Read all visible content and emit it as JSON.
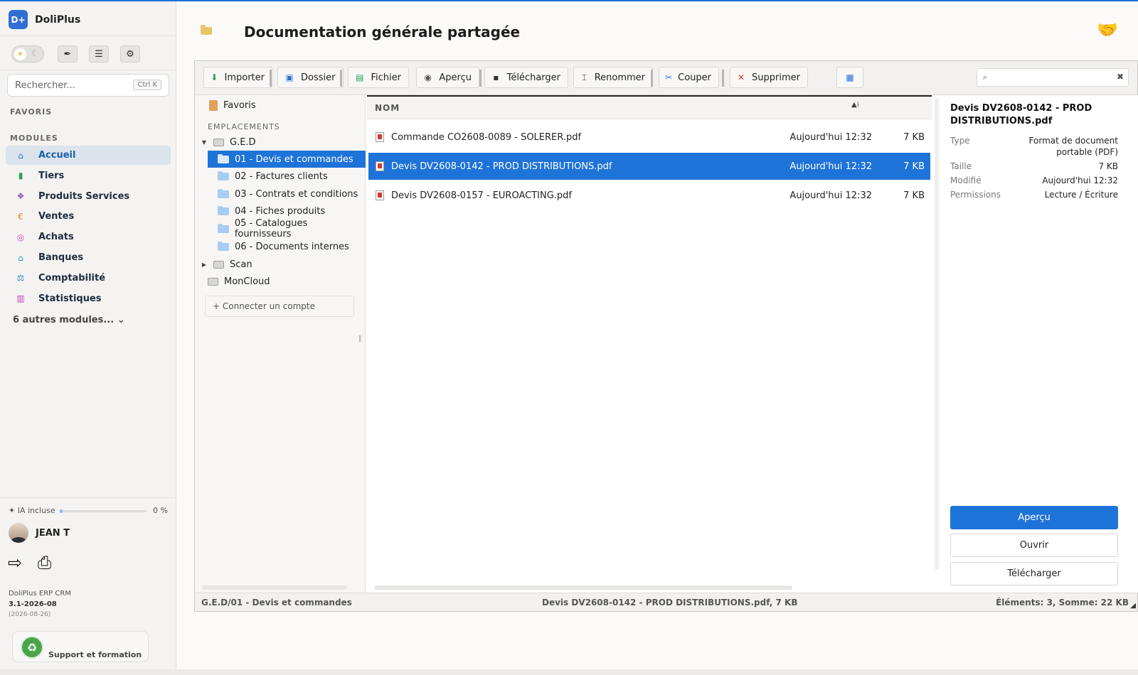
{
  "brand": {
    "logo": "D+",
    "name": "DoliPlus"
  },
  "sidebar": {
    "theme_toggle": {
      "sun": "☀",
      "moon": "☾"
    },
    "buttons": [
      "feather-icon",
      "list-icon",
      "gear-icon"
    ],
    "search": {
      "placeholder": "Rechercher...",
      "shortcut": "Ctrl K"
    },
    "favorites_title": "FAVORIS",
    "modules_title": "MODULES",
    "modules": [
      {
        "label": "Accueil",
        "icon": "home-icon",
        "color": "#2f6fd3",
        "active": true
      },
      {
        "label": "Tiers",
        "icon": "building-icon",
        "color": "#2a9d5c"
      },
      {
        "label": "Produits Services",
        "icon": "cubes-icon",
        "color": "#8a4fbf"
      },
      {
        "label": "Ventes",
        "icon": "euro-icon",
        "color": "#e08b1a"
      },
      {
        "label": "Achats",
        "icon": "coins-icon",
        "color": "#c845b8"
      },
      {
        "label": "Banques",
        "icon": "bank-icon",
        "color": "#2aa0a8"
      },
      {
        "label": "Comptabilité",
        "icon": "scale-icon",
        "color": "#2a7fc0"
      },
      {
        "label": "Statistiques",
        "icon": "chart-icon",
        "color": "#c845b8"
      }
    ],
    "more_modules": "6 autres modules... ⌄",
    "ia": {
      "label": "✦ IA incluse",
      "percent": "0 %",
      "value": 0
    },
    "user": {
      "name": "JEAN T"
    },
    "version": {
      "product": "DoliPlus ERP CRM",
      "version": "3.1-2026-08",
      "date": "(2026-08-26)"
    },
    "support": {
      "label": "Support et formation"
    }
  },
  "header": {
    "title": "Documentation générale partagée"
  },
  "toolbar": {
    "buttons": [
      {
        "label": "Importer",
        "icon": "import-icon"
      },
      {
        "label": "Dossier",
        "icon": "new-folder-icon"
      },
      {
        "label": "Fichier",
        "icon": "new-file-icon"
      },
      {
        "label": "Aperçu",
        "icon": "eye-icon"
      },
      {
        "label": "Télécharger",
        "icon": "save-icon"
      },
      {
        "label": "Renommer",
        "icon": "rename-icon"
      },
      {
        "label": "Couper",
        "icon": "scissors-icon"
      },
      {
        "label": "Supprimer",
        "icon": "delete-icon"
      }
    ],
    "search_value": ""
  },
  "nav": {
    "favorites": "Favoris",
    "locations_title": "EMPLACEMENTS",
    "root": "G.E.D",
    "folders": [
      "01 - Devis et commandes",
      "02 - Factures clients",
      "03 - Contrats et conditions",
      "04 - Fiches produits",
      "05 - Catalogues fournisseurs",
      "06 - Documents internes"
    ],
    "selected_folder": 0,
    "scan": "Scan",
    "cloud": "MonCloud",
    "connect": "+ Connecter un compte"
  },
  "list": {
    "column": "NOM",
    "files": [
      {
        "name": "Commande CO2608-0089 - SOLERER.pdf",
        "date": "Aujourd'hui 12:32",
        "size": "7 KB"
      },
      {
        "name": "Devis DV2608-0142 - PROD DISTRIBUTIONS.pdf",
        "date": "Aujourd'hui 12:32",
        "size": "7 KB"
      },
      {
        "name": "Devis DV2608-0157 - EUROACTING.pdf",
        "date": "Aujourd'hui 12:32",
        "size": "7 KB"
      }
    ],
    "selected_file": 1
  },
  "info": {
    "title": "Devis DV2608-0142 - PROD DISTRIBUTIONS.pdf",
    "rows": [
      {
        "k": "Type",
        "v": "Format de document portable (PDF)"
      },
      {
        "k": "Taille",
        "v": "7 KB"
      },
      {
        "k": "Modifié",
        "v": "Aujourd'hui 12:32"
      },
      {
        "k": "Permissions",
        "v": "Lecture / Écriture"
      }
    ],
    "actions": {
      "preview": "Aperçu",
      "open": "Ouvrir",
      "download": "Télécharger"
    }
  },
  "status": {
    "path": "G.E.D/01 - Devis et commandes",
    "selection": "Devis DV2608-0142 - PROD DISTRIBUTIONS.pdf, 7 KB",
    "summary": "Éléments: 3, Somme: 22 KB"
  },
  "colors": {
    "accent": "#1e73d8",
    "sidebar_bg": "#f4f3f2"
  }
}
